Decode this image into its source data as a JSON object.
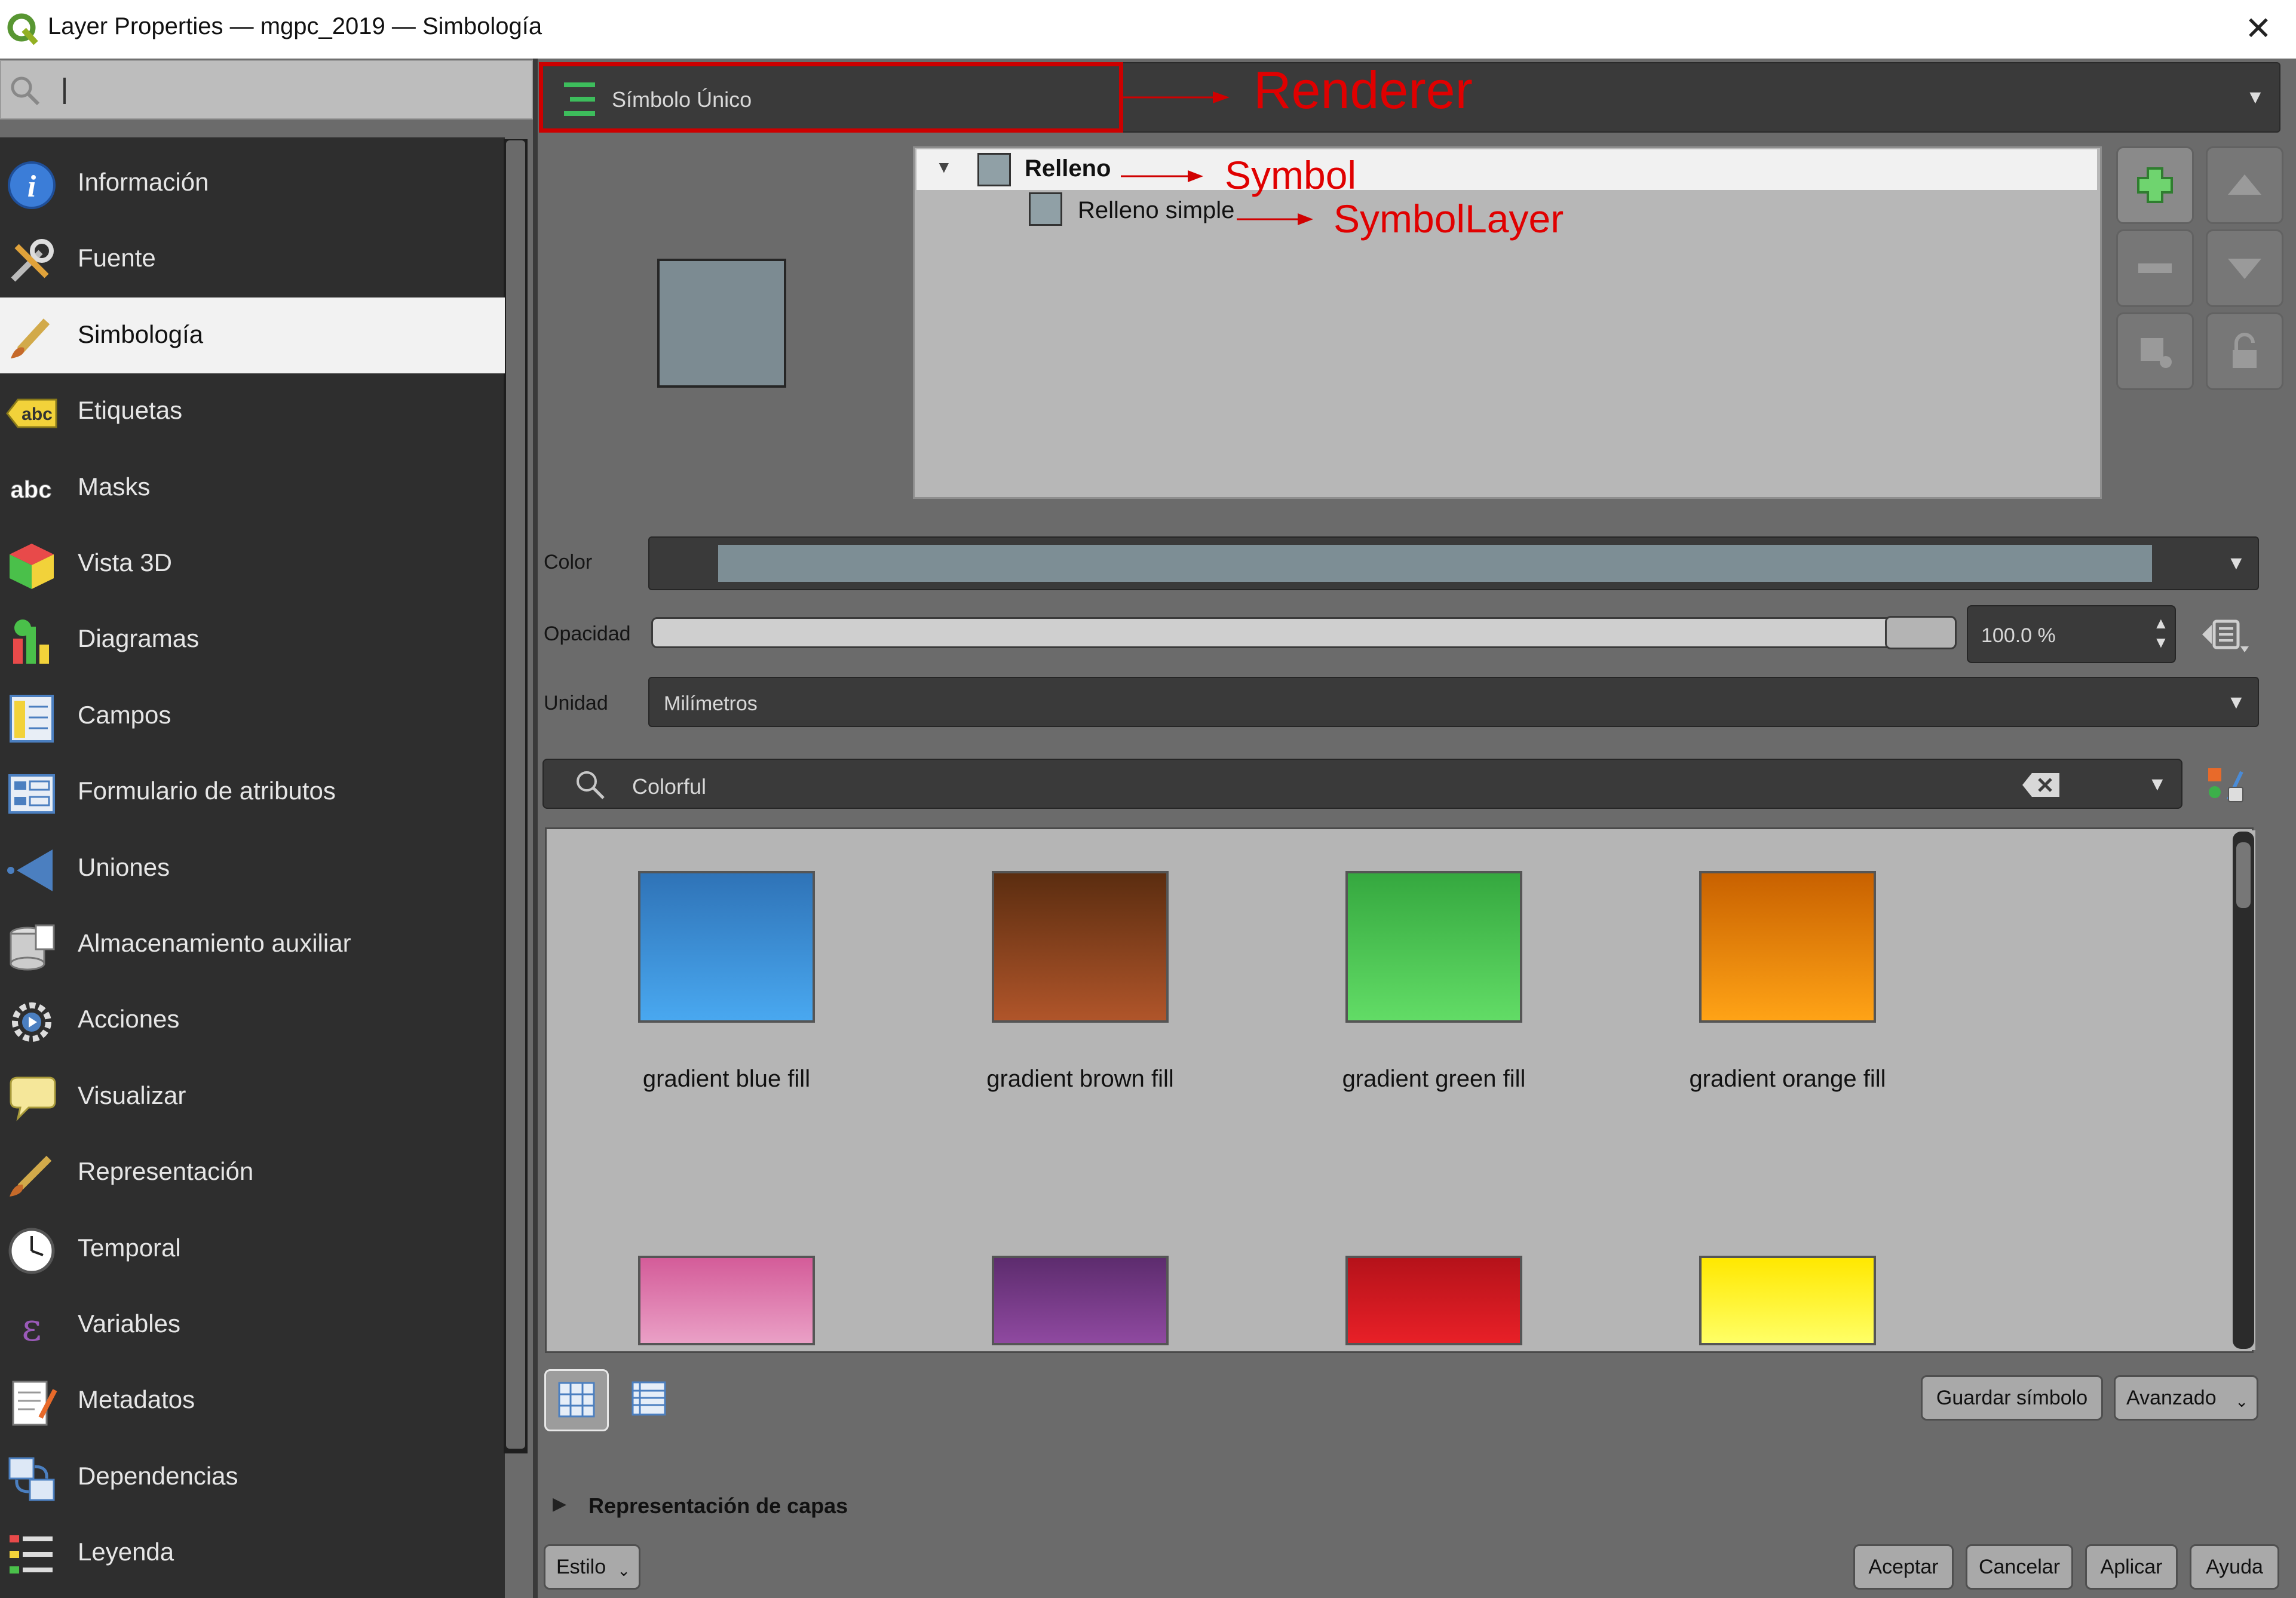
{
  "window": {
    "title": "Layer Properties — mgpc_2019 — Simbología",
    "close_glyph": "✕"
  },
  "sidebar": {
    "search": {
      "placeholder": ""
    },
    "items": [
      {
        "label": "Información",
        "icon": "info-icon"
      },
      {
        "label": "Fuente",
        "icon": "source-tools-icon"
      },
      {
        "label": "Simbología",
        "icon": "paintbrush-icon",
        "selected": true
      },
      {
        "label": "Etiquetas",
        "icon": "labels-abc-icon"
      },
      {
        "label": "Masks",
        "icon": "mask-abc-icon"
      },
      {
        "label": "Vista 3D",
        "icon": "cube-3d-icon"
      },
      {
        "label": "Diagramas",
        "icon": "diagram-icon"
      },
      {
        "label": "Campos",
        "icon": "fields-icon"
      },
      {
        "label": "Formulario de atributos",
        "icon": "attribute-form-icon"
      },
      {
        "label": "Uniones",
        "icon": "joins-icon"
      },
      {
        "label": "Almacenamiento auxiliar",
        "icon": "auxiliary-storage-icon"
      },
      {
        "label": "Acciones",
        "icon": "actions-gear-icon"
      },
      {
        "label": "Visualizar",
        "icon": "speech-bubble-icon"
      },
      {
        "label": "Representación",
        "icon": "render-brush-icon"
      },
      {
        "label": "Temporal",
        "icon": "clock-icon"
      },
      {
        "label": "Variables",
        "icon": "epsilon-icon"
      },
      {
        "label": "Metadatos",
        "icon": "metadata-icon"
      },
      {
        "label": "Dependencias",
        "icon": "dependencies-icon"
      },
      {
        "label": "Leyenda",
        "icon": "legend-icon"
      }
    ]
  },
  "renderer": {
    "label": "Símbolo Único",
    "icon": "single-symbol-icon"
  },
  "annotations": {
    "renderer": "Renderer",
    "symbol": "Symbol",
    "symbol_layer": "SymbolLayer"
  },
  "symbol_tree": {
    "root": {
      "label": "Relleno",
      "expanded": true
    },
    "layers": [
      {
        "label": "Relleno simple"
      }
    ]
  },
  "tree_buttons": {
    "add": "add-layer-icon",
    "remove": "remove-layer-icon",
    "duplicate": "duplicate-layer-icon",
    "up": "move-up-icon",
    "down": "move-down-icon",
    "lock": "lock-color-icon"
  },
  "properties": {
    "color_label": "Color",
    "color_value": "#7d8e95",
    "opacity_label": "Opacidad",
    "opacity_value": "100.0 %",
    "opacity_fraction": 1.0,
    "unit_label": "Unidad",
    "unit_value": "Milímetros"
  },
  "library": {
    "search_value": "Colorful",
    "symbols": [
      {
        "name": "gradient blue fill",
        "top": "#2f73b7",
        "bottom": "#49a8f0"
      },
      {
        "name": "gradient brown fill",
        "top": "#5b2d10",
        "bottom": "#b0552a"
      },
      {
        "name": "gradient green fill",
        "top": "#35a83f",
        "bottom": "#62dc66"
      },
      {
        "name": "gradient orange fill",
        "top": "#c86100",
        "bottom": "#ffa316"
      },
      {
        "name": "",
        "top": "#d45c99",
        "bottom": "#eaa0c6"
      },
      {
        "name": "",
        "top": "#5d2c6e",
        "bottom": "#8f49a0"
      },
      {
        "name": "",
        "top": "#b5121a",
        "bottom": "#e82027"
      },
      {
        "name": "",
        "top": "#ffe800",
        "bottom": "#ffff66"
      }
    ]
  },
  "bottom": {
    "save_symbol": "Guardar símbolo",
    "advanced": "Avanzado",
    "layer_rendering": "Representación de capas",
    "style": "Estilo",
    "accept": "Aceptar",
    "cancel": "Cancelar",
    "apply": "Aplicar",
    "help": "Ayuda"
  }
}
